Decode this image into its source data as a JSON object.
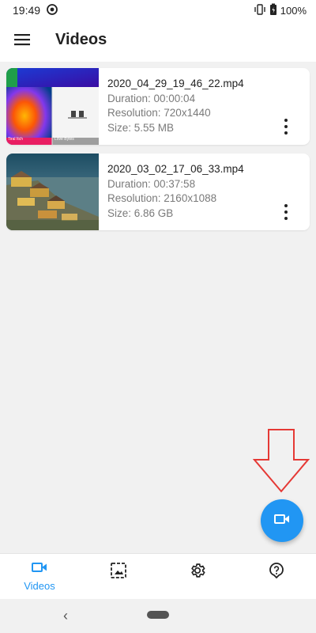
{
  "status_bar": {
    "time": "19:49",
    "battery": "100%"
  },
  "app_bar": {
    "title": "Videos"
  },
  "videos": [
    {
      "name": "2020_04_29_19_46_22.mp4",
      "duration": "Duration: 00:00:04",
      "resolution": "Resolution: 720x1440",
      "size": "Size: 5.55 MB",
      "thumb_caption_left": "Tiral Itch",
      "thumb_caption_right": "Love Bytes"
    },
    {
      "name": "2020_03_02_17_06_33.mp4",
      "duration": "Duration: 00:37:58",
      "resolution": "Resolution: 2160x1088",
      "size": "Size: 6.86 GB"
    }
  ],
  "bottom_nav": {
    "videos_label": "Videos"
  },
  "colors": {
    "accent": "#2196f3",
    "annotation": "#e53935"
  }
}
